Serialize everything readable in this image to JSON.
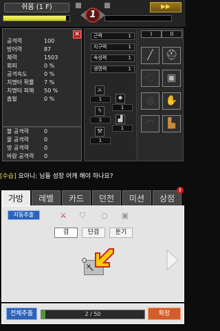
{
  "header": {
    "stage_label": "쉬움 (1 F)",
    "level": "1",
    "speed_label": "▶▶",
    "hp_fraction": 0.95,
    "mp_fraction": 0.0
  },
  "stats": [
    {
      "label": "공격력",
      "value": "100"
    },
    {
      "label": "방어력",
      "value": "87"
    },
    {
      "label": "체력",
      "value": "1503"
    },
    {
      "label": "회피",
      "value": "0 %"
    },
    {
      "label": "공격속도",
      "value": "0 %"
    },
    {
      "label": "치명타 확률",
      "value": "7 %"
    },
    {
      "label": "치명타 피해",
      "value": "50 %"
    },
    {
      "label": "흡혈",
      "value": "0 %"
    }
  ],
  "element_stats": [
    {
      "label": "불 공격력",
      "value": "0"
    },
    {
      "label": "물 공격력",
      "value": "0"
    },
    {
      "label": "땅 공격력",
      "value": "0"
    },
    {
      "label": "바람 공격력",
      "value": "0"
    }
  ],
  "attributes": [
    {
      "name": "근력",
      "value": "1"
    },
    {
      "name": "지구력",
      "value": "1"
    },
    {
      "name": "속성력",
      "value": "1"
    },
    {
      "name": "생명력",
      "value": "1"
    }
  ],
  "skills": [
    {
      "icon": "sword-skill-icon",
      "glyph": "⚔",
      "value": "1"
    },
    {
      "icon": "burst-skill-icon",
      "glyph": "✸",
      "value": "1"
    },
    {
      "icon": "lightning-skill-icon",
      "glyph": "ϟ",
      "value": "1"
    },
    {
      "icon": "castle-skill-icon",
      "glyph": "▟",
      "value": "1"
    },
    {
      "icon": "pickaxe-skill-icon",
      "glyph": "⚒",
      "value": "1"
    }
  ],
  "equipment": {
    "tabs": [
      "I",
      "II"
    ],
    "slots": [
      {
        "name": "weapon-slot",
        "glyph": "╱",
        "filled": true
      },
      {
        "name": "helmet-slot",
        "glyph": "⛑",
        "filled": true
      },
      {
        "name": "ring-slot",
        "glyph": "◌",
        "filled": false
      },
      {
        "name": "armor-slot",
        "glyph": "▣",
        "filled": true
      },
      {
        "name": "necklace-slot",
        "glyph": "◎",
        "filled": false
      },
      {
        "name": "glove-slot",
        "glyph": "✋",
        "filled": true
      },
      {
        "name": "belt-slot",
        "glyph": "◠",
        "filled": false
      },
      {
        "name": "boots-slot",
        "glyph": "▙",
        "filled": true
      }
    ]
  },
  "chat": {
    "tag": "[수습]",
    "message": " 요아니: 님들 성장 어캐 해야 하나요?"
  },
  "tabs": [
    "가방",
    "레벨",
    "카드",
    "던전",
    "미션",
    "상점"
  ],
  "tab_badge": "!",
  "inventory": {
    "auto_sort_label": "자동추출",
    "filter_icons": [
      "sword-filter-icon",
      "shield-filter-icon",
      "ring-filter-icon",
      "armor-filter-icon"
    ],
    "sub_tabs": [
      "검",
      "단검",
      "둔기"
    ]
  },
  "bottom": {
    "extract_all_label": "전체추출",
    "capacity_text": "2 / 50",
    "capacity_fraction": 0.04,
    "expand_label": "확장"
  },
  "colors": {
    "accent_blue": "#2e63b8",
    "hp_yellow": "#e8e840",
    "expand_orange": "#d25c2a",
    "capacity_green": "#4a9a3a"
  }
}
